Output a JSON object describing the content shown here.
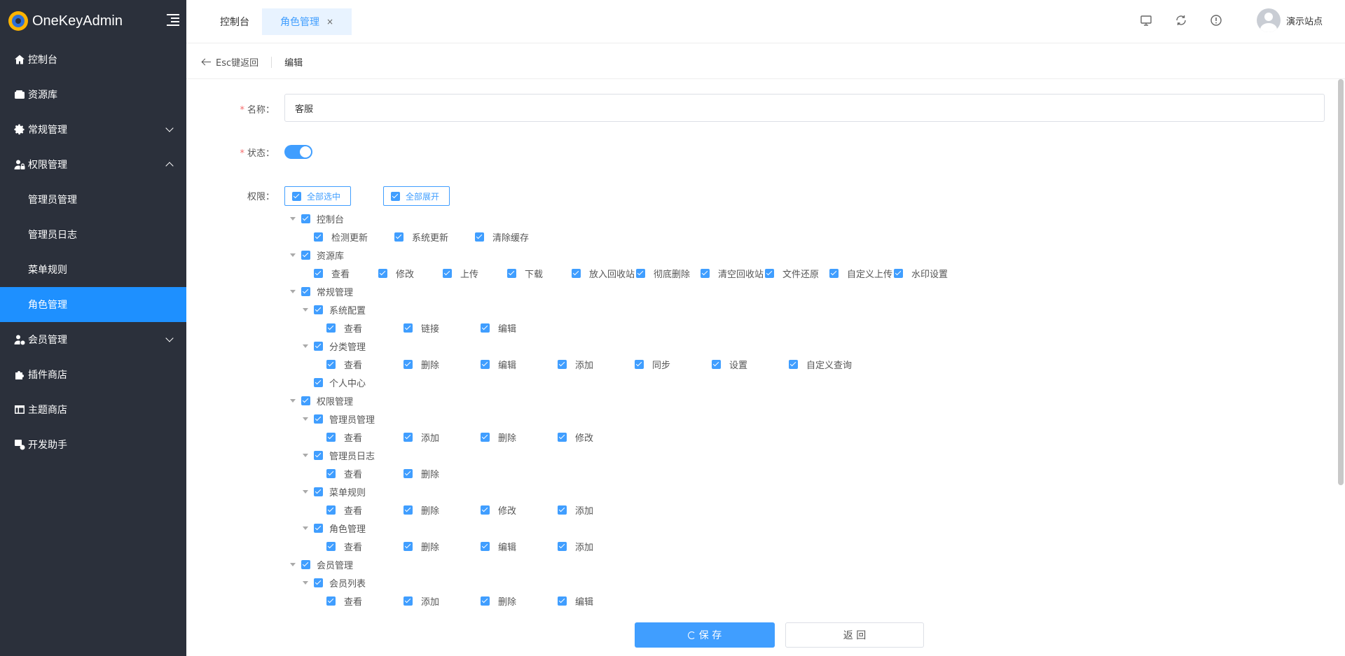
{
  "app": {
    "name": "OneKeyAdmin"
  },
  "sidebar": {
    "items": [
      {
        "label": "控制台",
        "icon": "home-icon"
      },
      {
        "label": "资源库",
        "icon": "wallet-icon"
      },
      {
        "label": "常规管理",
        "icon": "gear-icon",
        "expanded": false
      },
      {
        "label": "权限管理",
        "icon": "user-lock-icon",
        "expanded": true,
        "children": [
          "管理员管理",
          "管理员日志",
          "菜单规则",
          "角色管理"
        ],
        "active_child": "角色管理"
      },
      {
        "label": "会员管理",
        "icon": "user-gear-icon",
        "expanded": false
      },
      {
        "label": "插件商店",
        "icon": "puzzle-icon"
      },
      {
        "label": "主题商店",
        "icon": "layout-icon"
      },
      {
        "label": "开发助手",
        "icon": "dev-icon"
      }
    ]
  },
  "tabs": [
    {
      "label": "控制台",
      "active": false
    },
    {
      "label": "角色管理",
      "active": true,
      "close": "×"
    }
  ],
  "header": {
    "icons": [
      "monitor-icon",
      "refresh-icon",
      "info-icon"
    ],
    "user": "演示站点"
  },
  "page": {
    "back": "Esc键返回",
    "title": "编辑"
  },
  "form": {
    "name_label": "名称：",
    "name_value": "客服",
    "status_label": "状态：",
    "status_on": true,
    "perm_label": "权限：",
    "select_all": "全部选中",
    "expand_all": "全部展开",
    "required_mark": "*"
  },
  "tree": [
    {
      "label": "控制台",
      "leaves": [
        "检测更新",
        "系统更新",
        "清除缓存"
      ]
    },
    {
      "label": "资源库",
      "leaves": [
        "查看",
        "修改",
        "上传",
        "下载",
        "放入回收站",
        "彻底删除",
        "清空回收站",
        "文件还原",
        "自定义上传",
        "水印设置"
      ]
    },
    {
      "label": "常规管理",
      "children": [
        {
          "label": "系统配置",
          "leaves": [
            "查看",
            "链接",
            "编辑"
          ]
        },
        {
          "label": "分类管理",
          "leaves": [
            "查看",
            "删除",
            "编辑",
            "添加",
            "同步",
            "设置",
            "自定义查询"
          ]
        },
        {
          "label": "个人中心"
        }
      ]
    },
    {
      "label": "权限管理",
      "children": [
        {
          "label": "管理员管理",
          "leaves": [
            "查看",
            "添加",
            "删除",
            "修改"
          ]
        },
        {
          "label": "管理员日志",
          "leaves": [
            "查看",
            "删除"
          ]
        },
        {
          "label": "菜单规则",
          "leaves": [
            "查看",
            "删除",
            "修改",
            "添加"
          ]
        },
        {
          "label": "角色管理",
          "leaves": [
            "查看",
            "删除",
            "编辑",
            "添加"
          ]
        }
      ]
    },
    {
      "label": "会员管理",
      "children": [
        {
          "label": "会员列表",
          "leaves": [
            "查看",
            "添加",
            "删除",
            "编辑"
          ]
        }
      ]
    }
  ],
  "buttons": {
    "save": "保 存",
    "back": "返 回"
  },
  "colors": {
    "primary": "#409eff",
    "sidebar_bg": "#2b303b",
    "active_menu": "#1e90ff"
  }
}
